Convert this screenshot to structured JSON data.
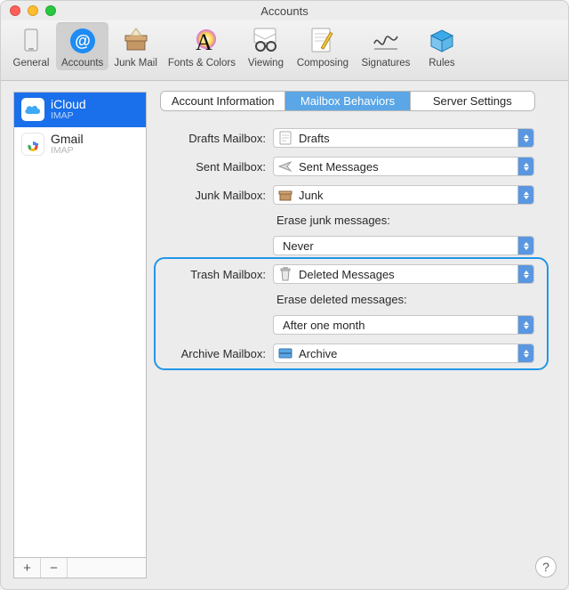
{
  "window": {
    "title": "Accounts"
  },
  "traffic": {
    "close": "close",
    "minimize": "minimize",
    "zoom": "zoom"
  },
  "toolbar": [
    {
      "key": "general",
      "label": "General"
    },
    {
      "key": "accounts",
      "label": "Accounts",
      "active": true
    },
    {
      "key": "junk",
      "label": "Junk Mail"
    },
    {
      "key": "fonts",
      "label": "Fonts & Colors"
    },
    {
      "key": "viewing",
      "label": "Viewing"
    },
    {
      "key": "composing",
      "label": "Composing"
    },
    {
      "key": "signatures",
      "label": "Signatures"
    },
    {
      "key": "rules",
      "label": "Rules"
    }
  ],
  "sidebar": {
    "accounts": [
      {
        "name": "iCloud",
        "protocol": "IMAP",
        "icon": "icloud",
        "selected": true
      },
      {
        "name": "Gmail",
        "protocol": "IMAP",
        "icon": "gmail",
        "selected": false
      }
    ],
    "add_label": "+",
    "remove_label": "−"
  },
  "tabs": [
    {
      "key": "account_info",
      "label": "Account Information"
    },
    {
      "key": "mailbox_behaviors",
      "label": "Mailbox Behaviors",
      "active": true
    },
    {
      "key": "server_settings",
      "label": "Server Settings"
    }
  ],
  "settings": {
    "drafts": {
      "label": "Drafts Mailbox:",
      "value": "Drafts",
      "icon": "doc"
    },
    "sent": {
      "label": "Sent Mailbox:",
      "value": "Sent Messages",
      "icon": "plane"
    },
    "junk": {
      "label": "Junk Mailbox:",
      "value": "Junk",
      "icon": "box"
    },
    "erase_junk": {
      "label": "Erase junk messages:",
      "value": "Never"
    },
    "trash": {
      "label": "Trash Mailbox:",
      "value": "Deleted Messages",
      "icon": "trash"
    },
    "erase_deleted": {
      "label": "Erase deleted messages:",
      "value": "After one month"
    },
    "archive": {
      "label": "Archive Mailbox:",
      "value": "Archive",
      "icon": "tray"
    }
  },
  "help": {
    "label": "?"
  },
  "colors": {
    "accent_dropdown": "#5a97e0",
    "selection": "#1a6fea",
    "highlight_border": "#2196e8"
  }
}
